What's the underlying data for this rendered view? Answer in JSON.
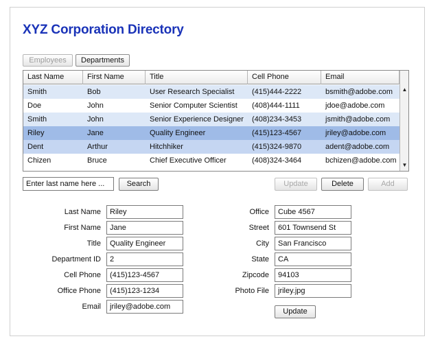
{
  "app": {
    "title": "XYZ Corporation Directory"
  },
  "tabs": {
    "employees": "Employees",
    "departments": "Departments"
  },
  "grid": {
    "columns": [
      "Last Name",
      "First Name",
      "Title",
      "Cell Phone",
      "Email"
    ],
    "rows": [
      [
        "Smith",
        "Bob",
        "User Research Specialist",
        "(415)444-2222",
        "bsmith@adobe.com"
      ],
      [
        "Doe",
        "John",
        "Senior Computer Scientist",
        "(408)444-1111",
        "jdoe@adobe.com"
      ],
      [
        "Smith",
        "John",
        "Senior Experience Designer",
        "(408)234-3453",
        "jsmith@adobe.com"
      ],
      [
        "Riley",
        "Jane",
        "Quality Engineer",
        "(415)123-4567",
        "jriley@adobe.com"
      ],
      [
        "Dent",
        "Arthur",
        "Hitchhiker",
        "(415)324-9870",
        "adent@adobe.com"
      ],
      [
        "Chizen",
        "Bruce",
        "Chief Executive Officer",
        "(408)324-3464",
        "bchizen@adobe.com"
      ]
    ],
    "selected_row_index": 3,
    "colors": {
      "row_alt": "#dde8f7",
      "row_base": "#ffffff",
      "row_selected": "#9fbbe7",
      "row_hover": "#c5d6f2"
    }
  },
  "search": {
    "value": "Enter last name here ...",
    "button": "Search"
  },
  "actions": {
    "update": "Update",
    "delete": "Delete",
    "add": "Add"
  },
  "form": {
    "left": [
      {
        "label": "Last Name",
        "value": "Riley"
      },
      {
        "label": "First Name",
        "value": "Jane"
      },
      {
        "label": "Title",
        "value": "Quality Engineer"
      },
      {
        "label": "Department ID",
        "value": "2"
      },
      {
        "label": "Cell Phone",
        "value": "(415)123-4567"
      },
      {
        "label": "Office Phone",
        "value": "(415)123-1234"
      },
      {
        "label": "Email",
        "value": "jriley@adobe.com"
      }
    ],
    "right": [
      {
        "label": "Office",
        "value": "Cube 4567"
      },
      {
        "label": "Street",
        "value": "601 Townsend St"
      },
      {
        "label": "City",
        "value": "San Francisco"
      },
      {
        "label": "State",
        "value": "CA"
      },
      {
        "label": "Zipcode",
        "value": "94103"
      },
      {
        "label": "Photo File",
        "value": "jriley.jpg"
      }
    ],
    "update_button": "Update"
  },
  "icons": {
    "scroll_up": "scroll-up-arrow-icon",
    "scroll_down": "scroll-down-arrow-icon"
  }
}
